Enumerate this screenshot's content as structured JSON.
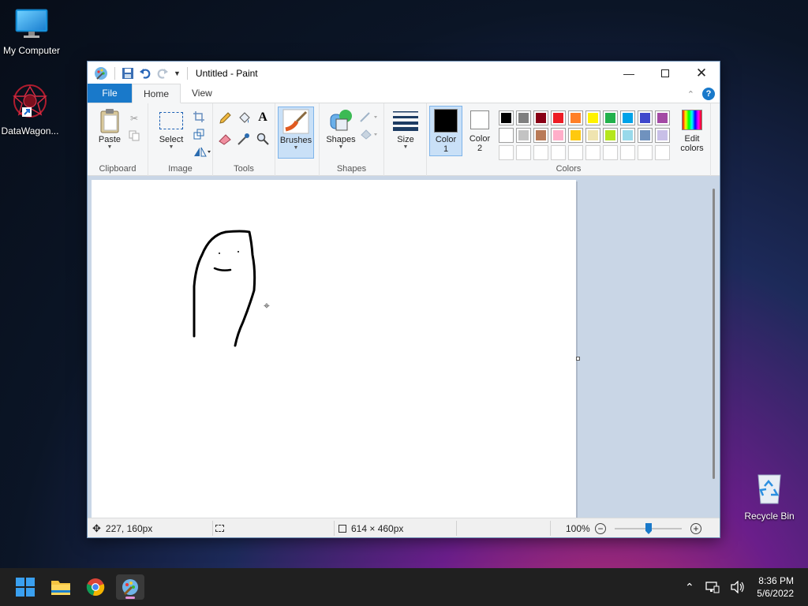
{
  "desktop": {
    "icons": [
      {
        "label": "My Computer"
      },
      {
        "label": "DataWagon..."
      },
      {
        "label": "Recycle Bin"
      }
    ]
  },
  "window": {
    "title": "Untitled - Paint",
    "tabs": [
      {
        "label": "File"
      },
      {
        "label": "Home"
      },
      {
        "label": "View"
      }
    ],
    "ribbon": {
      "clipboard": {
        "paste_label": "Paste",
        "group_label": "Clipboard"
      },
      "image": {
        "select_label": "Select",
        "group_label": "Image"
      },
      "tools": {
        "group_label": "Tools"
      },
      "brushes": {
        "label": "Brushes"
      },
      "shapes": {
        "label": "Shapes",
        "group_label": "Shapes"
      },
      "size": {
        "label": "Size"
      },
      "color1": {
        "label_line1": "Color",
        "label_line2": "1",
        "value": "#000000"
      },
      "color2": {
        "label_line1": "Color",
        "label_line2": "2",
        "value": "#ffffff"
      },
      "colors": {
        "group_label": "Colors",
        "palette_row1": [
          "#000000",
          "#7f7f7f",
          "#880015",
          "#ed1c24",
          "#ff7f27",
          "#fff200",
          "#22b14c",
          "#00a2e8",
          "#3f48cc",
          "#a349a4"
        ],
        "palette_row2": [
          "#ffffff",
          "#c3c3c3",
          "#b97a57",
          "#ffaec9",
          "#ffc90e",
          "#efe4b0",
          "#b5e61d",
          "#99d9ea",
          "#7092be",
          "#c8bfe7"
        ],
        "palette_row3_count": 10
      },
      "edit_colors": {
        "label_line1": "Edit",
        "label_line2": "colors"
      }
    },
    "status": {
      "cursor_pos": "227, 160px",
      "selection_size": "",
      "canvas_size": "614 × 460px",
      "zoom": "100%"
    }
  },
  "taskbar": {
    "apps": [
      {
        "name": "start-button"
      },
      {
        "name": "file-explorer"
      },
      {
        "name": "chrome"
      },
      {
        "name": "paint",
        "active": true
      }
    ],
    "time": "8:36 PM",
    "date": "5/6/2022"
  }
}
